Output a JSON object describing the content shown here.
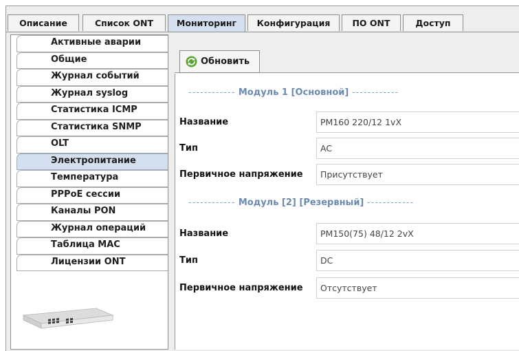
{
  "tabs": [
    "Описание",
    "Список ONT",
    "Мониторинг",
    "Конфигурация",
    "ПО ONT",
    "Доступ"
  ],
  "active_tab": "Мониторинг",
  "sidebar": {
    "items": [
      {
        "label": "Активные аварии"
      },
      {
        "label": "Общие"
      },
      {
        "label": "Журнал событий"
      },
      {
        "label": "Журнал syslog"
      },
      {
        "label": "Статистика ICMP"
      },
      {
        "label": "Статистика SNMP"
      },
      {
        "label": "OLT"
      },
      {
        "label": "Электропитание"
      },
      {
        "label": "Температура"
      },
      {
        "label": "PPPoE сессии"
      },
      {
        "label": "Каналы PON"
      },
      {
        "label": "Журнал операций"
      },
      {
        "label": "Таблица МАС"
      },
      {
        "label": "Лицензии ONT"
      }
    ],
    "active": "Электропитание"
  },
  "toolbar": {
    "refresh_label": "Обновить",
    "refresh_icon": "refresh-icon"
  },
  "modules": [
    {
      "header": "Модуль 1 [Основной]",
      "dashes": "------------",
      "rows": [
        {
          "label": "Название",
          "value": "PM160 220/12 1vX"
        },
        {
          "label": "Тип",
          "value": "AC"
        },
        {
          "label": "Первичное напряжение",
          "value": "Присутствует"
        }
      ]
    },
    {
      "header": "Модуль [2] [Резервный]",
      "dashes": "------------",
      "rows": [
        {
          "label": "Название",
          "value": "PM150(75) 48/12 2vX"
        },
        {
          "label": "Тип",
          "value": "DC"
        },
        {
          "label": "Первичное напряжение",
          "value": "Отсутствует"
        }
      ]
    }
  ],
  "colors": {
    "accent": "#d4e0ef",
    "section_header": "#6b8ab0"
  }
}
